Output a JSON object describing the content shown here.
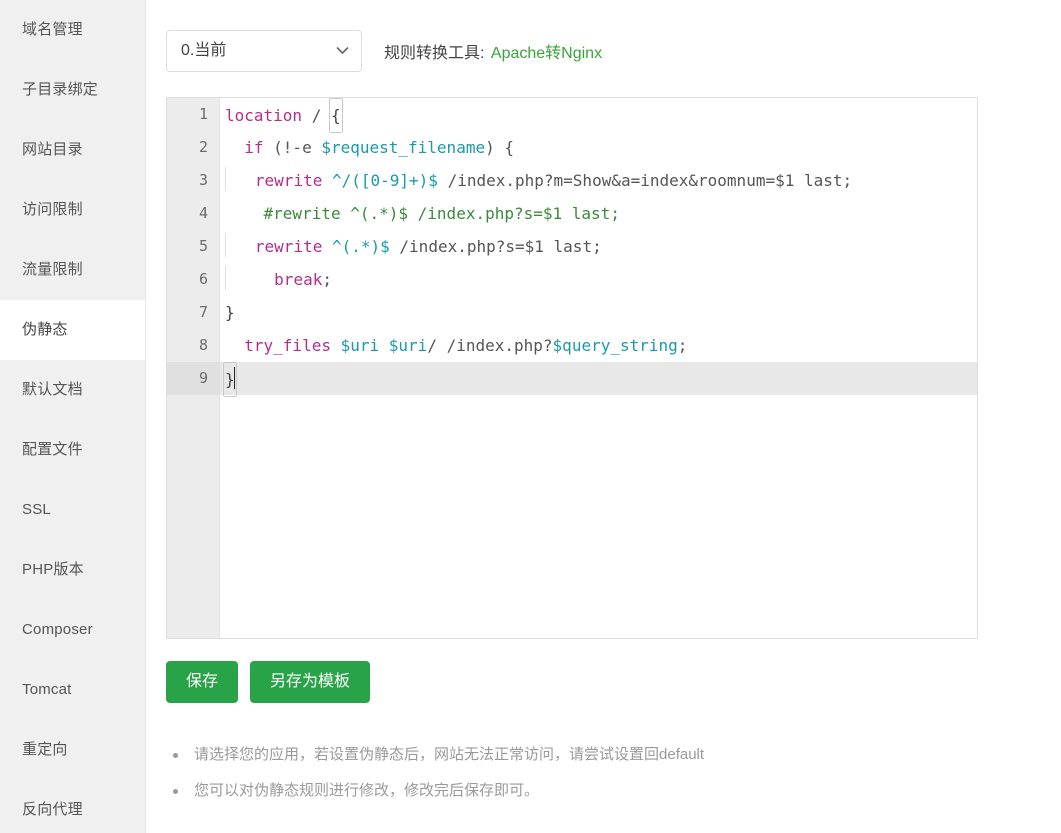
{
  "sidebar": {
    "items": [
      {
        "label": "域名管理",
        "active": false
      },
      {
        "label": "子目录绑定",
        "active": false
      },
      {
        "label": "网站目录",
        "active": false
      },
      {
        "label": "访问限制",
        "active": false
      },
      {
        "label": "流量限制",
        "active": false
      },
      {
        "label": "伪静态",
        "active": true
      },
      {
        "label": "默认文档",
        "active": false
      },
      {
        "label": "配置文件",
        "active": false
      },
      {
        "label": "SSL",
        "active": false
      },
      {
        "label": "PHP版本",
        "active": false
      },
      {
        "label": "Composer",
        "active": false
      },
      {
        "label": "Tomcat",
        "active": false
      },
      {
        "label": "重定向",
        "active": false
      },
      {
        "label": "反向代理",
        "active": false
      }
    ]
  },
  "toolbar": {
    "select_value": "0.当前",
    "select_options": [
      "0.当前"
    ],
    "chevron_icon": "chevron-down-icon",
    "converter_label": "规则转换工具:",
    "converter_link": "Apache转Nginx",
    "link_color": "#3aa33a"
  },
  "editor": {
    "line_numbers": [
      "1",
      "2",
      "3",
      "4",
      "5",
      "6",
      "7",
      "8",
      "9"
    ],
    "active_line": 9,
    "cursor_line": 9,
    "lines": [
      "location / {",
      "  if (!-e $request_filename) {",
      "    rewrite ^/([0-9]+)$ /index.php?m=Show&a=index&roomnum=$1 last;",
      "    #rewrite ^(.*)$ /index.php?s=$1 last;",
      "    rewrite ^(.*)$ /index.php?s=$1 last;",
      "      break;",
      "}",
      "  try_files $uri $uri/ /index.php?$query_string;",
      "}"
    ],
    "tokens": {
      "l1_kw": "location",
      "l1_path": " / ",
      "l1_brace": "{",
      "l2_kw": "if",
      "l2_a": " (!-e ",
      "l2_var": "$request_filename",
      "l2_b": ") {",
      "l3_kw": "rewrite",
      "l3_rx": " ^/([0-9]+)$",
      "l3_rest": " /index.php?m=Show&a=index&roomnum=$1 last;",
      "l4_cm": "#rewrite ^(.*)$ /index.php?s=$1 last;",
      "l5_kw": "rewrite",
      "l5_rx": " ^(.*)$",
      "l5_rest": " /index.php?s=$1 last;",
      "l6_kw": "break",
      "l6_semi": ";",
      "l7_brace": "}",
      "l8_kw": "try_files",
      "l8_sp1": " ",
      "l8_var1": "$uri",
      "l8_sp2": " ",
      "l8_var2": "$uri",
      "l8_sp3": "/ /index.php?",
      "l8_var3": "$query_string",
      "l8_semi": ";",
      "l9_brace": "}"
    }
  },
  "buttons": {
    "save": "保存",
    "save_as_template": "另存为模板",
    "color": "#28a347"
  },
  "notes": [
    "请选择您的应用，若设置伪静态后，网站无法正常访问，请尝试设置回default",
    "您可以对伪静态规则进行修改，修改完后保存即可。"
  ]
}
